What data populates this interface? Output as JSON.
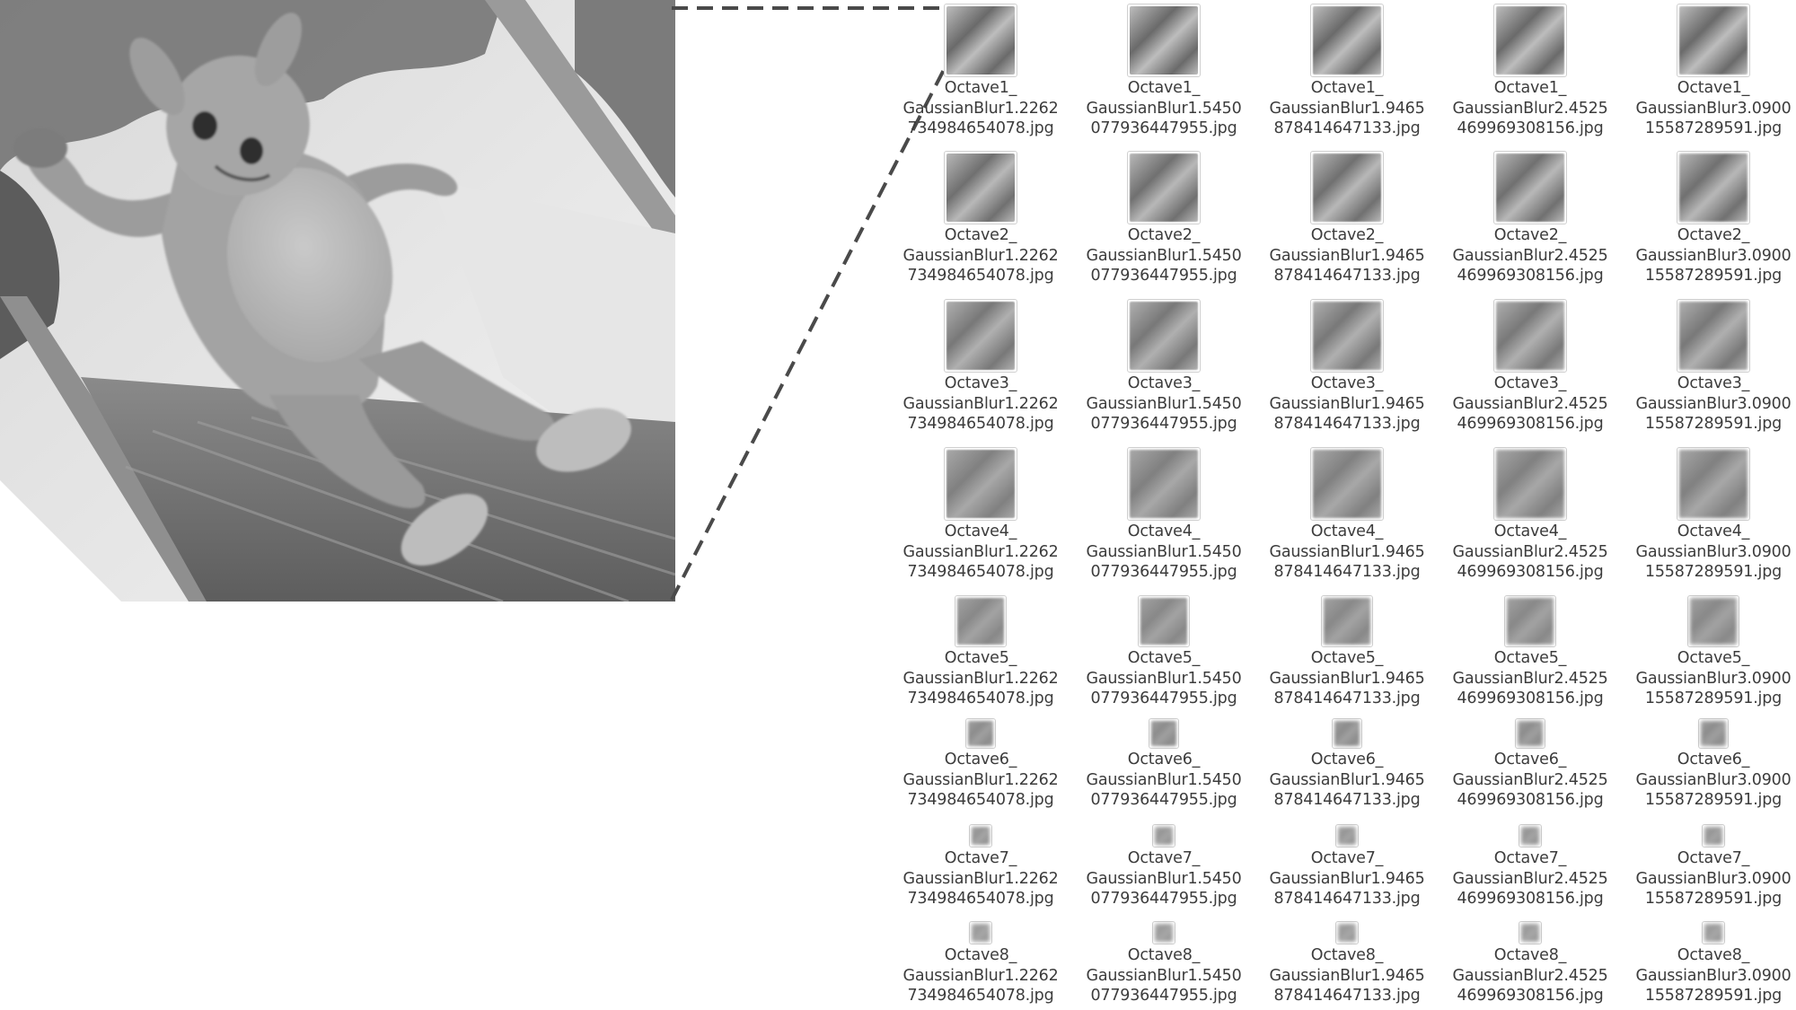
{
  "preview": {
    "subject": "mascot-costume-photo",
    "grayscale": true
  },
  "file_browser": {
    "columns": [
      "GaussianBlur1.2262734984654078",
      "GaussianBlur1.5450077936447955",
      "GaussianBlur1.9465878414647133",
      "GaussianBlur2.4525469969308156",
      "GaussianBlur3.0900155872 89591"
    ],
    "rows": [
      {
        "octave": "Octave1",
        "files": [
          {
            "line1": "Octave1_",
            "line2": "GaussianBlur1.2262",
            "line3": "734984654078.jpg"
          },
          {
            "line1": "Octave1_",
            "line2": "GaussianBlur1.5450",
            "line3": "077936447955.jpg"
          },
          {
            "line1": "Octave1_",
            "line2": "GaussianBlur1.9465",
            "line3": "878414647133.jpg"
          },
          {
            "line1": "Octave1_",
            "line2": "GaussianBlur2.4525",
            "line3": "469969308156.jpg"
          },
          {
            "line1": "Octave1_",
            "line2": "GaussianBlur3.0900",
            "line3": "15587289591.jpg"
          }
        ]
      },
      {
        "octave": "Octave2",
        "files": [
          {
            "line1": "Octave2_",
            "line2": "GaussianBlur1.2262",
            "line3": "734984654078.jpg"
          },
          {
            "line1": "Octave2_",
            "line2": "GaussianBlur1.5450",
            "line3": "077936447955.jpg"
          },
          {
            "line1": "Octave2_",
            "line2": "GaussianBlur1.9465",
            "line3": "878414647133.jpg"
          },
          {
            "line1": "Octave2_",
            "line2": "GaussianBlur2.4525",
            "line3": "469969308156.jpg"
          },
          {
            "line1": "Octave2_",
            "line2": "GaussianBlur3.0900",
            "line3": "15587289591.jpg"
          }
        ]
      },
      {
        "octave": "Octave3",
        "files": [
          {
            "line1": "Octave3_",
            "line2": "GaussianBlur1.2262",
            "line3": "734984654078.jpg"
          },
          {
            "line1": "Octave3_",
            "line2": "GaussianBlur1.5450",
            "line3": "077936447955.jpg"
          },
          {
            "line1": "Octave3_",
            "line2": "GaussianBlur1.9465",
            "line3": "878414647133.jpg"
          },
          {
            "line1": "Octave3_",
            "line2": "GaussianBlur2.4525",
            "line3": "469969308156.jpg"
          },
          {
            "line1": "Octave3_",
            "line2": "GaussianBlur3.0900",
            "line3": "15587289591.jpg"
          }
        ]
      },
      {
        "octave": "Octave4",
        "files": [
          {
            "line1": "Octave4_",
            "line2": "GaussianBlur1.2262",
            "line3": "734984654078.jpg"
          },
          {
            "line1": "Octave4_",
            "line2": "GaussianBlur1.5450",
            "line3": "077936447955.jpg"
          },
          {
            "line1": "Octave4_",
            "line2": "GaussianBlur1.9465",
            "line3": "878414647133.jpg"
          },
          {
            "line1": "Octave4_",
            "line2": "GaussianBlur2.4525",
            "line3": "469969308156.jpg"
          },
          {
            "line1": "Octave4_",
            "line2": "GaussianBlur3.0900",
            "line3": "15587289591.jpg"
          }
        ]
      },
      {
        "octave": "Octave5",
        "files": [
          {
            "line1": "Octave5_",
            "line2": "GaussianBlur1.2262",
            "line3": "734984654078.jpg"
          },
          {
            "line1": "Octave5_",
            "line2": "GaussianBlur1.5450",
            "line3": "077936447955.jpg"
          },
          {
            "line1": "Octave5_",
            "line2": "GaussianBlur1.9465",
            "line3": "878414647133.jpg"
          },
          {
            "line1": "Octave5_",
            "line2": "GaussianBlur2.4525",
            "line3": "469969308156.jpg"
          },
          {
            "line1": "Octave5_",
            "line2": "GaussianBlur3.0900",
            "line3": "15587289591.jpg"
          }
        ]
      },
      {
        "octave": "Octave6",
        "files": [
          {
            "line1": "Octave6_",
            "line2": "GaussianBlur1.2262",
            "line3": "734984654078.jpg"
          },
          {
            "line1": "Octave6_",
            "line2": "GaussianBlur1.5450",
            "line3": "077936447955.jpg"
          },
          {
            "line1": "Octave6_",
            "line2": "GaussianBlur1.9465",
            "line3": "878414647133.jpg"
          },
          {
            "line1": "Octave6_",
            "line2": "GaussianBlur2.4525",
            "line3": "469969308156.jpg"
          },
          {
            "line1": "Octave6_",
            "line2": "GaussianBlur3.0900",
            "line3": "15587289591.jpg"
          }
        ]
      },
      {
        "octave": "Octave7",
        "files": [
          {
            "line1": "Octave7_",
            "line2": "GaussianBlur1.2262",
            "line3": "734984654078.jpg"
          },
          {
            "line1": "Octave7_",
            "line2": "GaussianBlur1.5450",
            "line3": "077936447955.jpg"
          },
          {
            "line1": "Octave7_",
            "line2": "GaussianBlur1.9465",
            "line3": "878414647133.jpg"
          },
          {
            "line1": "Octave7_",
            "line2": "GaussianBlur2.4525",
            "line3": "469969308156.jpg"
          },
          {
            "line1": "Octave7_",
            "line2": "GaussianBlur3.0900",
            "line3": "15587289591.jpg"
          }
        ]
      },
      {
        "octave": "Octave8",
        "files": [
          {
            "line1": "Octave8_",
            "line2": "GaussianBlur1.2262",
            "line3": "734984654078.jpg"
          },
          {
            "line1": "Octave8_",
            "line2": "GaussianBlur1.5450",
            "line3": "077936447955.jpg"
          },
          {
            "line1": "Octave8_",
            "line2": "GaussianBlur1.9465",
            "line3": "878414647133.jpg"
          },
          {
            "line1": "Octave8_",
            "line2": "GaussianBlur2.4525",
            "line3": "469969308156.jpg"
          },
          {
            "line1": "Octave8_",
            "line2": "GaussianBlur3.0900",
            "line3": "15587289591.jpg"
          }
        ]
      }
    ]
  },
  "colors": {
    "text": "#3c3c3c",
    "thumb_border": "#cfcfcf",
    "connector": "#4a4a4a"
  }
}
